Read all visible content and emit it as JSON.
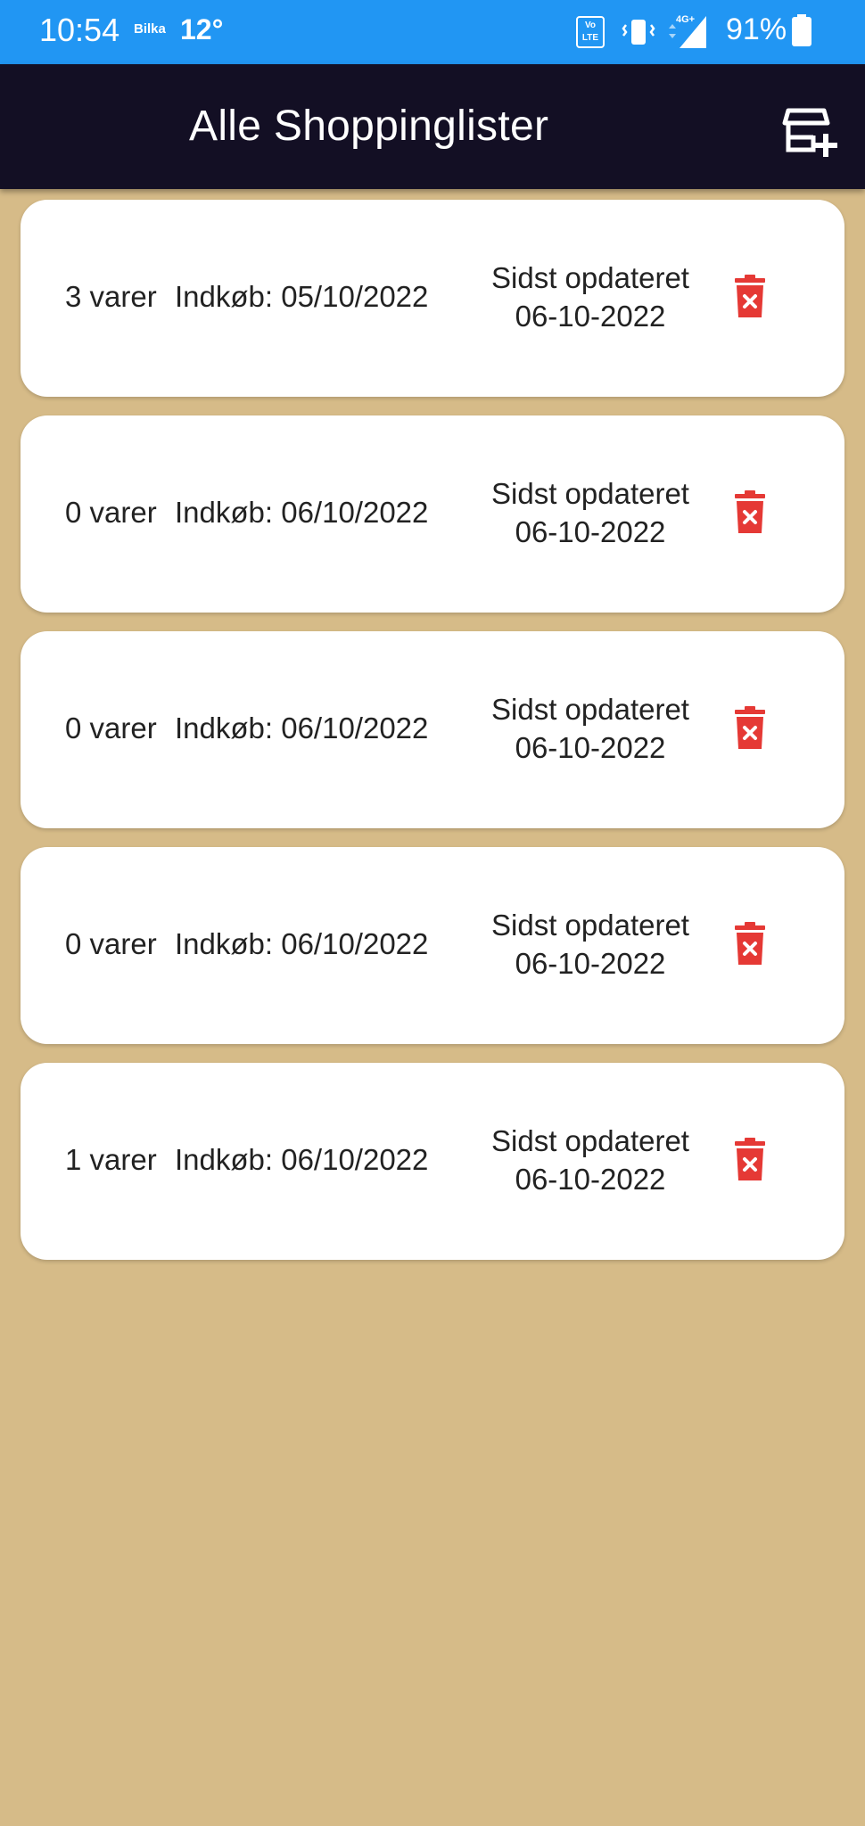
{
  "status_bar": {
    "time": "10:54",
    "carrier_badge": "Bilka",
    "temperature": "12°",
    "volte": "Vo LTE",
    "network": "4G+",
    "battery_percent": "91%",
    "icons": [
      "volte-icon",
      "vibrate-icon",
      "signal-icon",
      "battery-icon"
    ]
  },
  "app_bar": {
    "title": "Alle Shoppinglister",
    "action_icon": "add-store-icon"
  },
  "lists": [
    {
      "count": "3 varer",
      "purchase": "Indkøb: 05/10/2022",
      "updated_label": "Sidst opdateret",
      "updated_date": "06-10-2022"
    },
    {
      "count": "0 varer",
      "purchase": "Indkøb: 06/10/2022",
      "updated_label": "Sidst opdateret",
      "updated_date": "06-10-2022"
    },
    {
      "count": "0 varer",
      "purchase": "Indkøb: 06/10/2022",
      "updated_label": "Sidst opdateret",
      "updated_date": "06-10-2022"
    },
    {
      "count": "0 varer",
      "purchase": "Indkøb: 06/10/2022",
      "updated_label": "Sidst opdateret",
      "updated_date": "06-10-2022"
    },
    {
      "count": "1 varer",
      "purchase": "Indkøb: 06/10/2022",
      "updated_label": "Sidst opdateret",
      "updated_date": "06-10-2022"
    }
  ],
  "colors": {
    "status_bar": "#2196f3",
    "app_bar": "#130f24",
    "background": "#d6bb88",
    "card": "#ffffff",
    "delete": "#e53935"
  }
}
